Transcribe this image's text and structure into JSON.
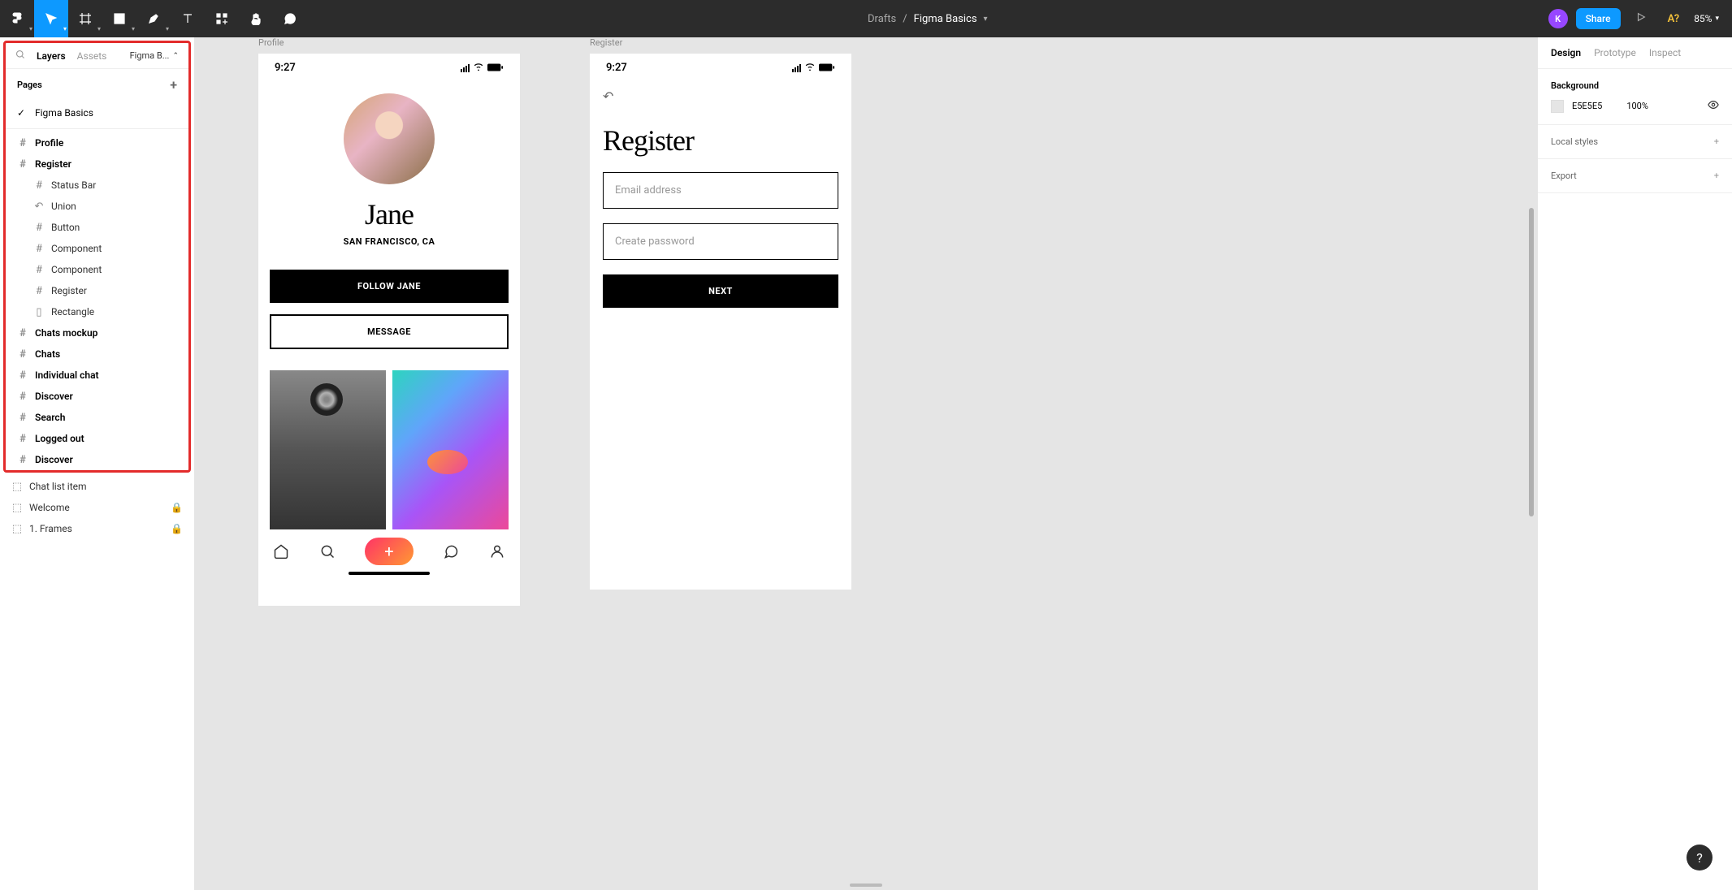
{
  "toolbar": {
    "breadcrumb_parent": "Drafts",
    "breadcrumb_sep": "/",
    "doc_name": "Figma Basics",
    "avatar_letter": "K",
    "share_label": "Share",
    "missing_fonts": "A?",
    "zoom": "85%"
  },
  "left_panel": {
    "tab_layers": "Layers",
    "tab_assets": "Assets",
    "file_selector": "Figma B...",
    "pages_header": "Pages",
    "page_current": "Figma Basics",
    "layers_top": [
      {
        "icon": "frame",
        "label": "Profile",
        "bold": true
      },
      {
        "icon": "frame",
        "label": "Register",
        "bold": true
      }
    ],
    "layers_nested": [
      {
        "icon": "frame",
        "label": "Status Bar"
      },
      {
        "icon": "union",
        "label": "Union"
      },
      {
        "icon": "frame",
        "label": "Button"
      },
      {
        "icon": "frame",
        "label": "Component"
      },
      {
        "icon": "frame",
        "label": "Component"
      },
      {
        "icon": "frame",
        "label": "Register"
      },
      {
        "icon": "rect",
        "label": "Rectangle"
      }
    ],
    "layers_bottom": [
      {
        "icon": "frame",
        "label": "Chats mockup",
        "bold": true
      },
      {
        "icon": "frame",
        "label": "Chats",
        "bold": true
      },
      {
        "icon": "frame",
        "label": "Individual chat",
        "bold": true
      },
      {
        "icon": "frame",
        "label": "Discover",
        "bold": true
      },
      {
        "icon": "frame",
        "label": "Search",
        "bold": true
      },
      {
        "icon": "frame",
        "label": "Logged out",
        "bold": true
      },
      {
        "icon": "frame",
        "label": "Discover",
        "bold": true
      }
    ],
    "layers_outside": [
      {
        "icon": "comp",
        "label": "Chat list item",
        "locked": false
      },
      {
        "icon": "comp",
        "label": "Welcome",
        "locked": true
      },
      {
        "icon": "comp",
        "label": "1. Frames",
        "locked": true
      }
    ]
  },
  "canvas": {
    "profile": {
      "frame_label": "Profile",
      "time": "9:27",
      "name": "Jane",
      "location": "SAN FRANCISCO, CA",
      "follow_btn": "FOLLOW JANE",
      "message_btn": "MESSAGE"
    },
    "register": {
      "frame_label": "Register",
      "time": "9:27",
      "title": "Register",
      "email_placeholder": "Email address",
      "password_placeholder": "Create password",
      "next_btn": "NEXT"
    }
  },
  "right_panel": {
    "tab_design": "Design",
    "tab_prototype": "Prototype",
    "tab_inspect": "Inspect",
    "background_title": "Background",
    "bg_color": "E5E5E5",
    "bg_opacity": "100%",
    "local_styles": "Local styles",
    "export": "Export"
  },
  "help": "?"
}
